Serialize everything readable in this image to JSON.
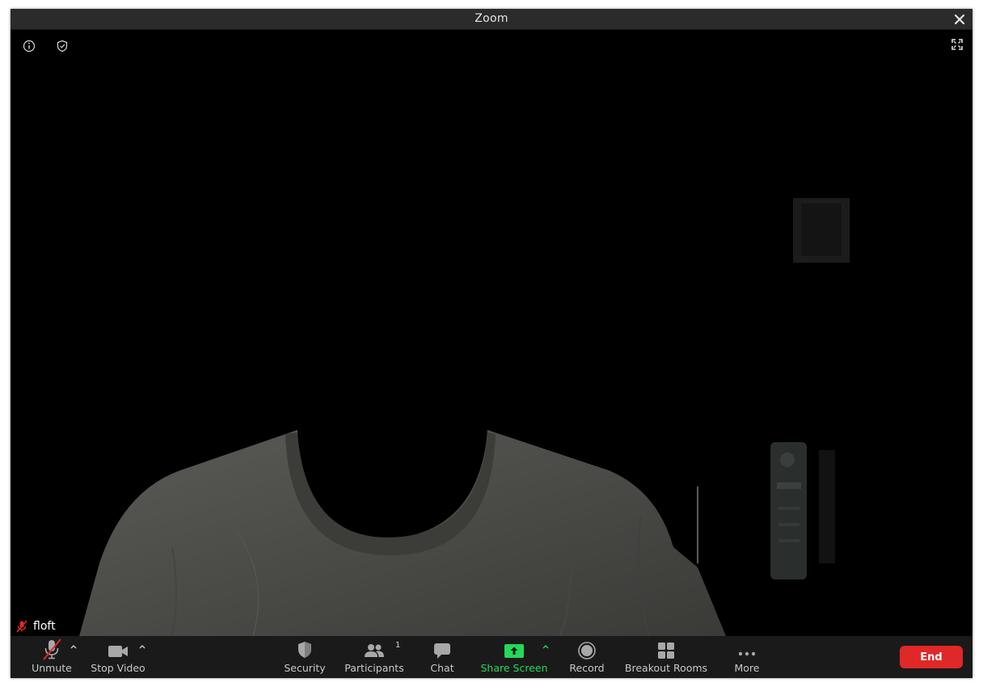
{
  "window": {
    "title": "Zoom"
  },
  "video": {
    "participant_name": "floft",
    "participant_muted": true
  },
  "toolbar": {
    "unmute_label": "Unmute",
    "stop_video_label": "Stop Video",
    "security_label": "Security",
    "participants_label": "Participants",
    "participants_count": "1",
    "chat_label": "Chat",
    "share_screen_label": "Share Screen",
    "record_label": "Record",
    "breakout_rooms_label": "Breakout Rooms",
    "more_label": "More",
    "end_label": "End"
  },
  "colors": {
    "accent_green": "#23d959",
    "end_red": "#e02828",
    "toolbar_bg": "#1a1a1a",
    "muted_red": "#e02828"
  },
  "icons": {
    "top_left": [
      "info-icon",
      "shield-check-icon"
    ],
    "top_right": "fullscreen-icon",
    "title_close": "close-icon"
  }
}
